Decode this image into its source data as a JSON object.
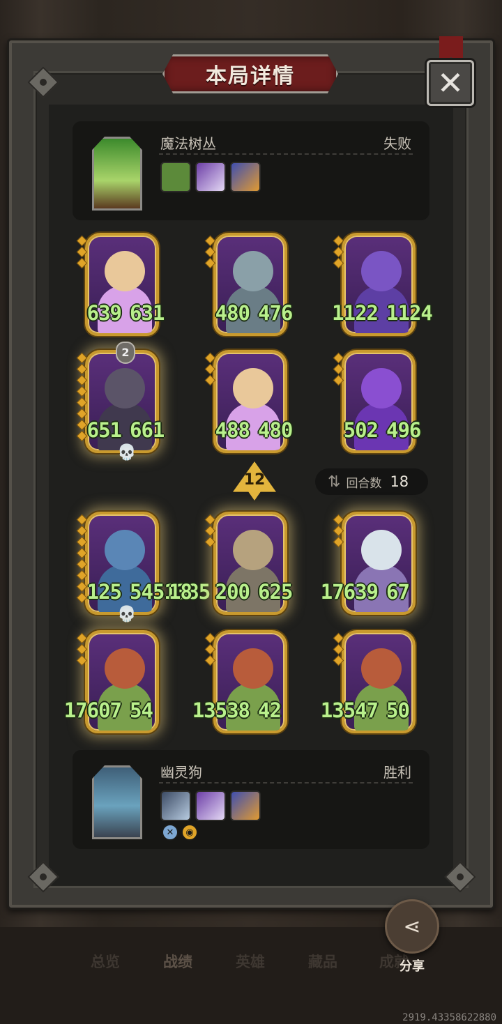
{
  "title": "本局详情",
  "close_icon": "✕",
  "opponent": {
    "name": "魔法树丛",
    "result": "失败",
    "items": [
      "door-item-icon",
      "scroll-item-icon",
      "treasure-item-icon"
    ]
  },
  "player": {
    "name": "幽灵狗",
    "result": "胜利",
    "items": [
      "dragon-item-icon",
      "scroll-item-icon",
      "treasure-item-icon"
    ],
    "skills": [
      "sword-skill-icon",
      "gold-skill-icon"
    ]
  },
  "opponent_units": [
    {
      "atk": "639",
      "hp": "631",
      "color": "#e9c89a",
      "body": "#d8a2e8"
    },
    {
      "atk": "480",
      "hp": "476",
      "color": "#8aa0a8",
      "body": "#6a7d86"
    },
    {
      "atk": "1122",
      "hp": "1124",
      "color": "#7a55c4",
      "body": "#5d3fa4"
    },
    {
      "atk": "651",
      "hp": "661",
      "color": "#5b5468",
      "body": "#40394e",
      "level": "2",
      "dead": true
    },
    {
      "atk": "488",
      "hp": "480",
      "color": "#e9c89a",
      "body": "#d8a2e8"
    },
    {
      "atk": "502",
      "hp": "496",
      "color": "#8a4fd1",
      "body": "#6b36b2"
    }
  ],
  "turn": {
    "value": "12"
  },
  "round": {
    "label": "回合数",
    "value": "18"
  },
  "player_units": [
    {
      "atk": "125",
      "hp": "5451385",
      "extra": "18",
      "color": "#5a86b6",
      "body": "#3f6b9b",
      "dead": true
    },
    {
      "atk": "200",
      "hp": "625",
      "color": "#b6a27e",
      "body": "#7d7566"
    },
    {
      "atk": "17639",
      "hp": "67",
      "color": "#d9e3ea",
      "body": "#8a75b4"
    },
    {
      "atk": "17607",
      "hp": "54",
      "color": "#b85c3b",
      "body": "#7aa04c"
    },
    {
      "atk": "13538",
      "hp": "42",
      "color": "#b85c3b",
      "body": "#7aa04c"
    },
    {
      "atk": "13547",
      "hp": "50",
      "color": "#b85c3b",
      "body": "#7aa04c"
    }
  ],
  "tabs": [
    "总览",
    "战绩",
    "英雄",
    "藏品",
    "成就"
  ],
  "share": {
    "label": "分享",
    "icon": "share-icon"
  },
  "coord_text": "2919.43358622880"
}
